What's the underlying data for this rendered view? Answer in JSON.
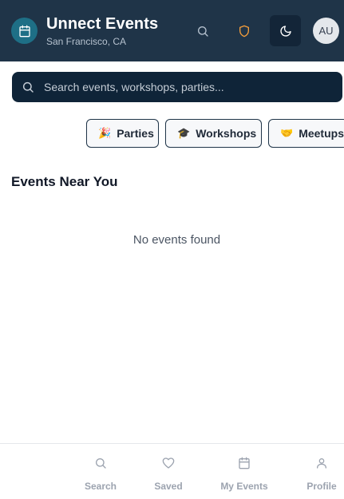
{
  "header": {
    "title": "Unnect Events",
    "location": "San Francisco, CA",
    "avatar_initials": "AU",
    "colors": {
      "background": "#1f3448",
      "logo_badge": "#1e6f86",
      "shield_accent": "#f59e3b"
    },
    "icons": [
      "calendar-icon",
      "search-icon",
      "shield-icon",
      "moon-icon"
    ]
  },
  "search": {
    "placeholder": "Search events, workshops, parties...",
    "value": ""
  },
  "categories": [
    {
      "emoji": "🎉",
      "label": "Parties"
    },
    {
      "emoji": "🎓",
      "label": "Workshops"
    },
    {
      "emoji": "🤝",
      "label": "Meetups"
    }
  ],
  "events_section": {
    "title": "Events Near You",
    "empty_message": "No events found"
  },
  "bottom_nav": {
    "items": [
      {
        "label": "Search",
        "icon": "search-icon"
      },
      {
        "label": "Saved",
        "icon": "heart-icon"
      },
      {
        "label": "My Events",
        "icon": "calendar-icon"
      },
      {
        "label": "Profile",
        "icon": "user-icon"
      }
    ],
    "inactive_color": "#9ca3af"
  }
}
